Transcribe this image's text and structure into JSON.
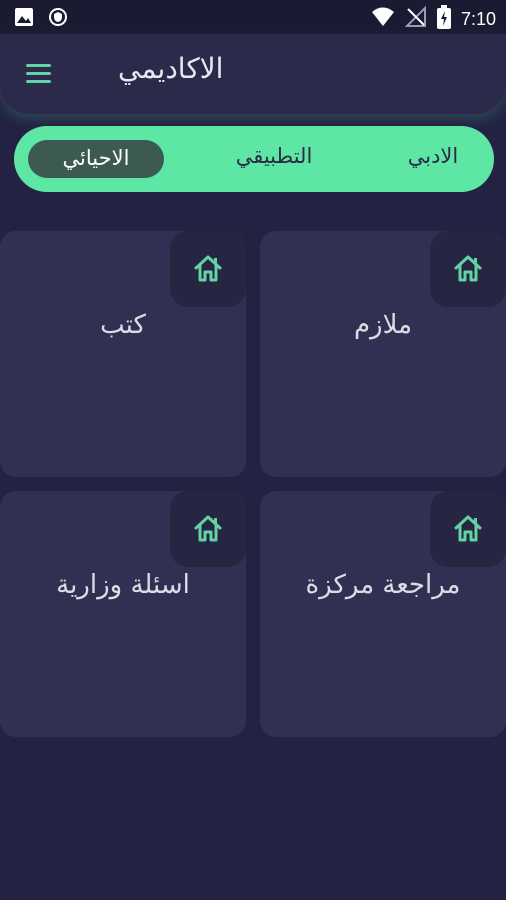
{
  "status_bar": {
    "time": "7:10",
    "left_icons": [
      "image-icon",
      "shield-icon"
    ],
    "right_icons": [
      "wifi-icon",
      "no-signal-icon",
      "battery-charging-icon"
    ]
  },
  "header": {
    "title": "الاكاديمي",
    "menu_icon": "hamburger-menu-icon"
  },
  "tabs": [
    {
      "label": "الادبي",
      "selected": false
    },
    {
      "label": "التطبيقي",
      "selected": false
    },
    {
      "label": "الاحيائي",
      "selected": true
    }
  ],
  "cards": [
    {
      "label": "ملازم",
      "icon": "home-icon"
    },
    {
      "label": "كتب",
      "icon": "home-icon"
    },
    {
      "label": "مراجعة مركزة",
      "icon": "home-icon"
    },
    {
      "label": "اسئلة وزارية",
      "icon": "home-icon"
    }
  ],
  "colors": {
    "background": "#232243",
    "header": "#2b2a4b",
    "accent": "#5ee6a4",
    "card": "#323052",
    "selected_tab": "#3c5a52"
  }
}
